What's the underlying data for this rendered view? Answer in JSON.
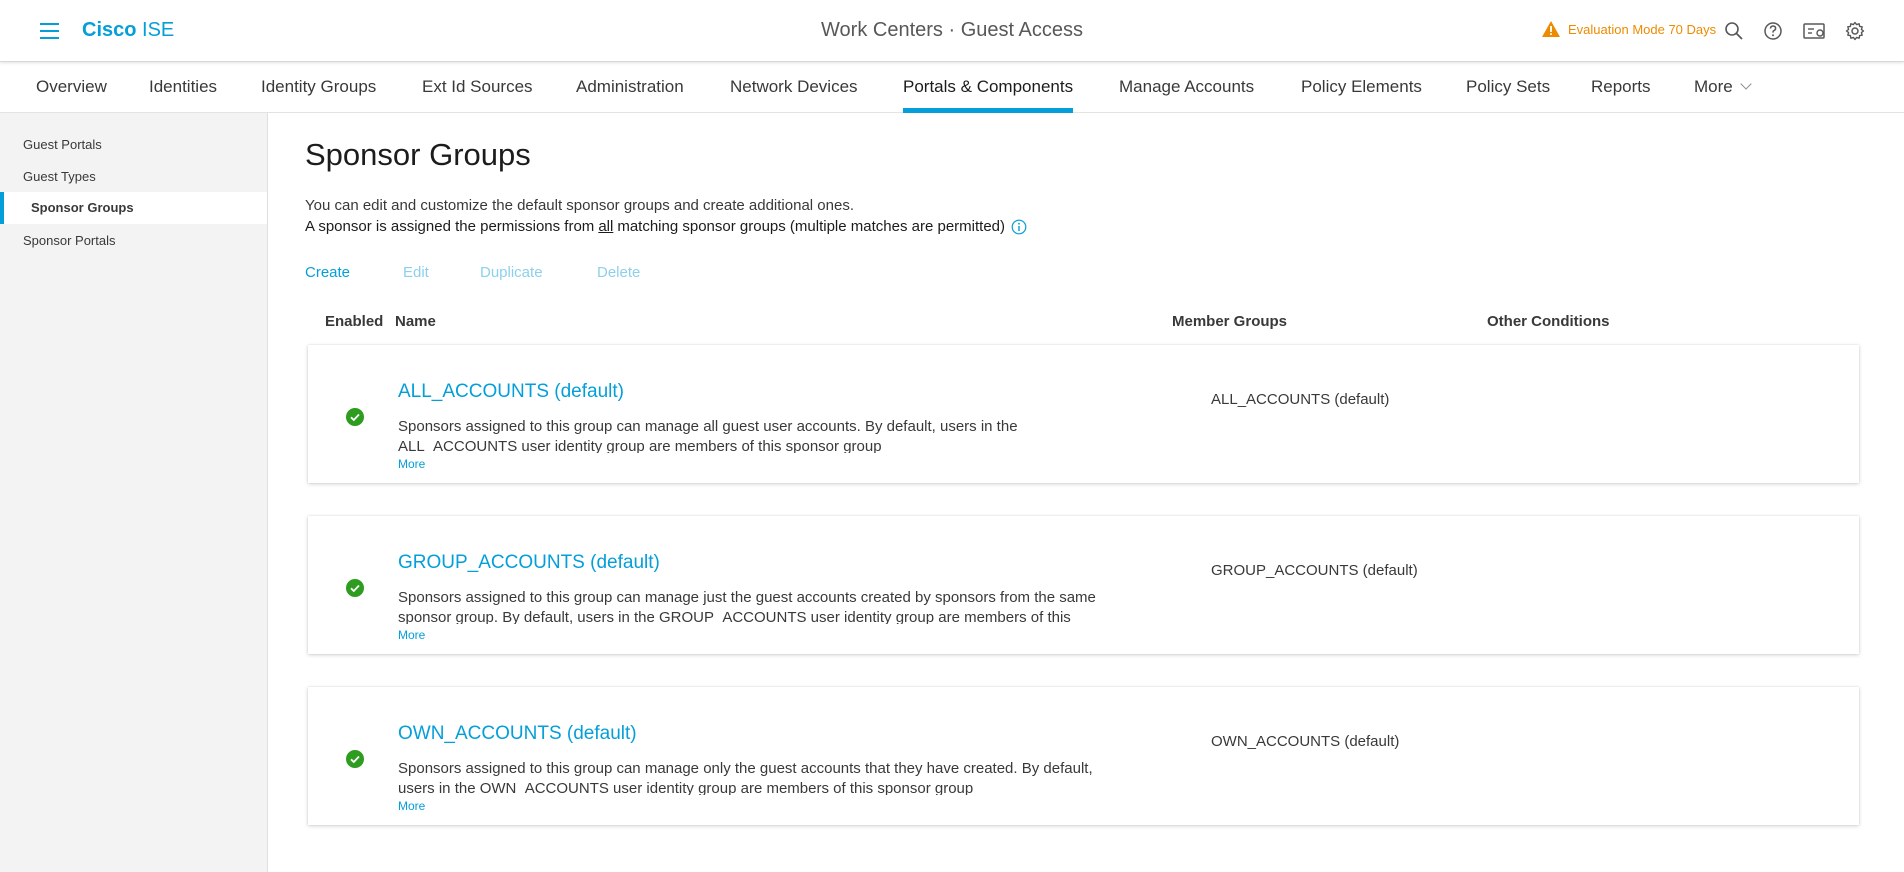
{
  "header": {
    "brand_bold": "Cisco",
    "brand_light": "ISE",
    "context": "Work Centers · Guest Access",
    "evaluation": "Evaluation Mode 70 Days",
    "icons": [
      "search-icon",
      "help-icon",
      "notifications-icon",
      "settings-icon"
    ],
    "accent_color": "#049fd9",
    "warning_color": "#ed8b00"
  },
  "tabs": [
    {
      "label": "Overview"
    },
    {
      "label": "Identities"
    },
    {
      "label": "Identity Groups"
    },
    {
      "label": "Ext Id Sources"
    },
    {
      "label": "Administration"
    },
    {
      "label": "Network Devices"
    },
    {
      "label": "Portals & Components",
      "active": true
    },
    {
      "label": "Manage Accounts"
    },
    {
      "label": "Policy Elements"
    },
    {
      "label": "Policy Sets"
    },
    {
      "label": "Reports"
    },
    {
      "label": "More"
    }
  ],
  "sidebar": {
    "items": [
      {
        "label": "Guest Portals"
      },
      {
        "label": "Guest Types"
      },
      {
        "label": "Sponsor Groups",
        "active": true
      },
      {
        "label": "Sponsor Portals"
      }
    ]
  },
  "main": {
    "title": "Sponsor Groups",
    "description_line1": "You can edit and customize the default sponsor groups and create additional ones.",
    "description_line2_pre": "A sponsor is assigned the permissions from",
    "description_line2_underline": "all",
    "description_line2_post": "matching sponsor groups (multiple matches are permitted)",
    "actions": {
      "create": "Create",
      "edit": "Edit",
      "duplicate": "Duplicate",
      "delete": "Delete"
    },
    "columns": {
      "enabled": "Enabled",
      "name": "Name",
      "member_groups": "Member Groups",
      "other_conditions": "Other Conditions"
    },
    "groups": [
      {
        "name": "ALL_ACCOUNTS (default)",
        "description": "Sponsors assigned to this group can manage all guest user accounts. By default, users in the ALL_ACCOUNTS user identity group are members of this sponsor group",
        "more": "More",
        "member_groups": "ALL_ACCOUNTS (default)",
        "enabled": true
      },
      {
        "name": "GROUP_ACCOUNTS (default)",
        "description": "Sponsors assigned to this group can manage just the guest accounts created by sponsors from the same sponsor group. By default, users in the GROUP_ACCOUNTS user identity group are members of this sponsor group",
        "more": "More",
        "member_groups": "GROUP_ACCOUNTS (default)",
        "enabled": true
      },
      {
        "name": "OWN_ACCOUNTS (default)",
        "description": "Sponsors assigned to this group can manage only the guest accounts that they have created. By default, users in the OWN_ACCOUNTS user identity group are members of this sponsor group",
        "more": "More",
        "member_groups": "OWN_ACCOUNTS (default)",
        "enabled": true
      }
    ],
    "enabled_color": "#2e9c1f"
  }
}
